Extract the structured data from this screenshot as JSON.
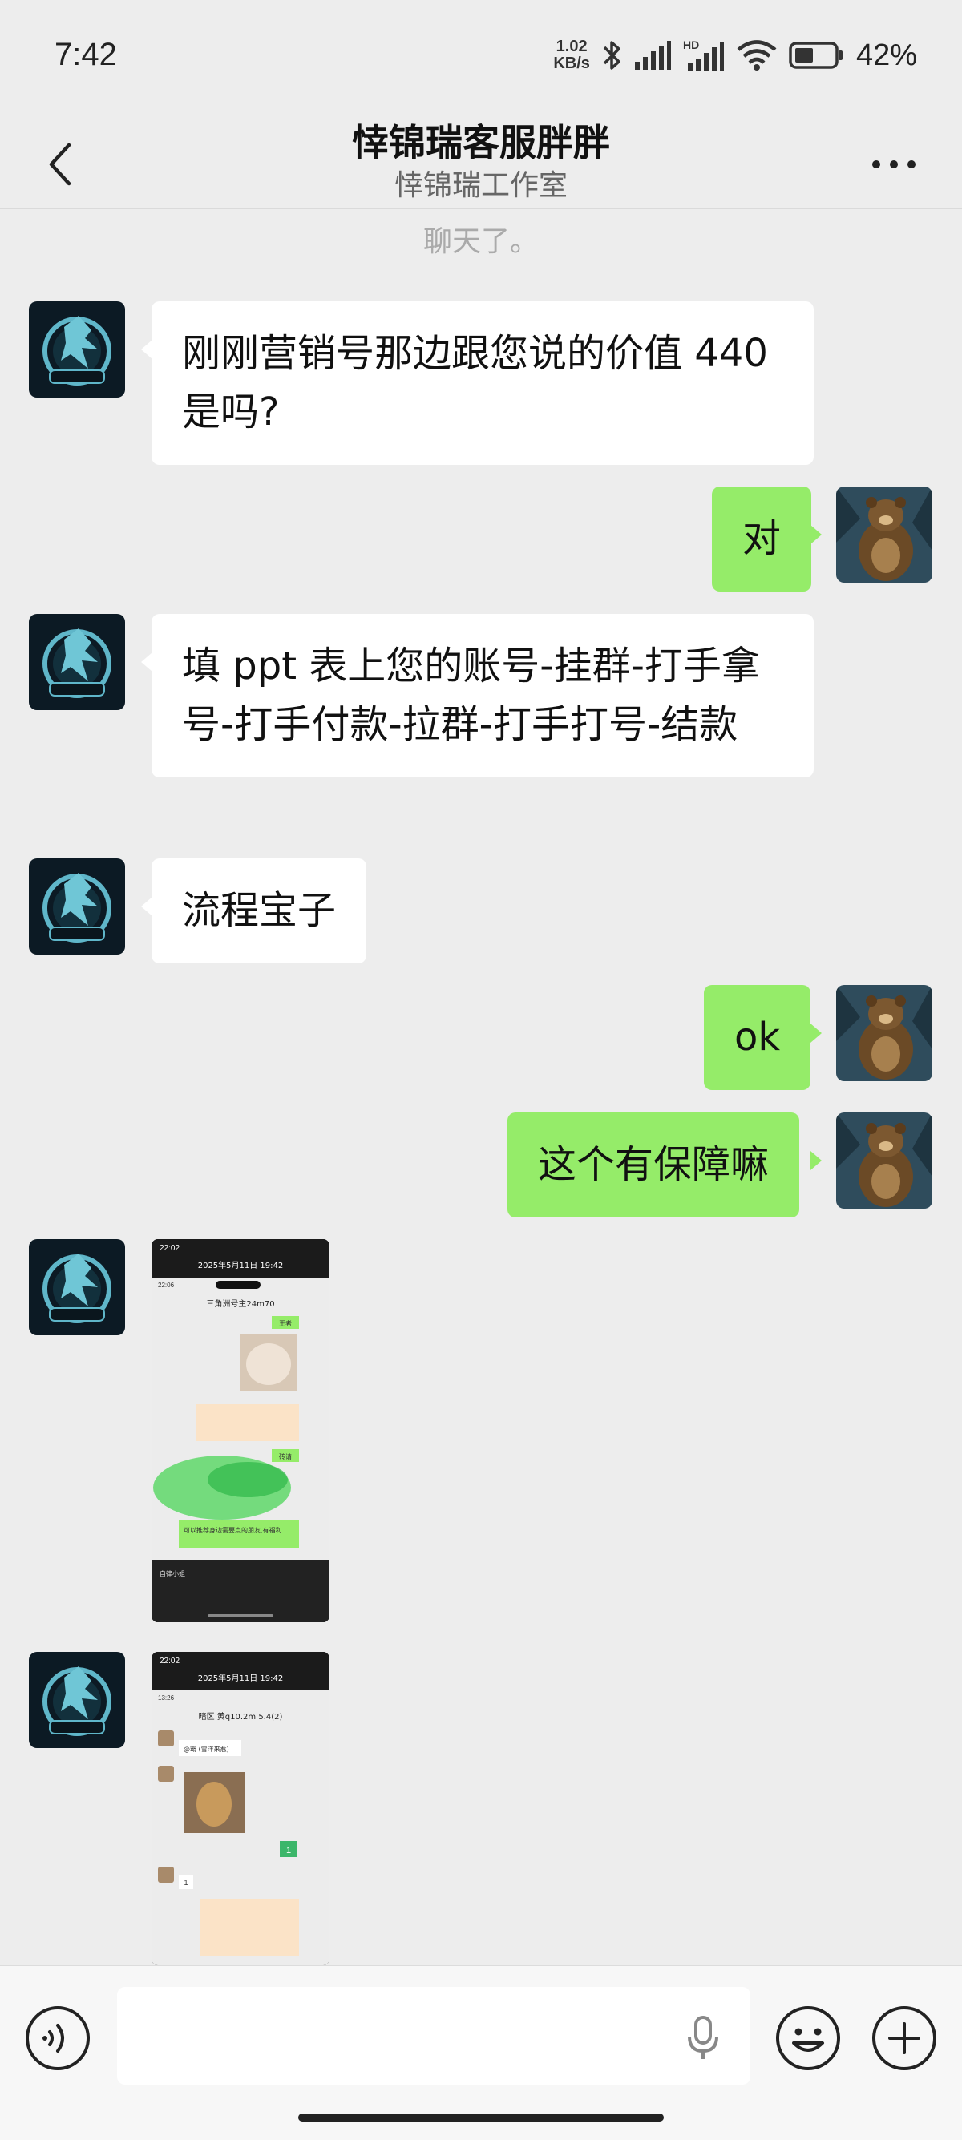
{
  "status_bar": {
    "time": "7:42",
    "net_speed_value": "1.02",
    "net_speed_unit": "KB/s",
    "hd_label": "HD",
    "battery_percent": "42%",
    "icons": [
      "bluetooth-icon",
      "signal-icon",
      "hd-signal-icon",
      "wifi-icon",
      "battery-icon"
    ]
  },
  "header": {
    "title": "悻锦瑞客服胖胖",
    "subtitle": "悻锦瑞工作室",
    "back_icon": "back-arrow-icon",
    "more_icon": "more-icon"
  },
  "system_message": "聊天了。",
  "messages": [
    {
      "side": "left",
      "type": "text",
      "text": "刚刚营销号那边跟您说的价值 440 是吗?"
    },
    {
      "side": "right",
      "type": "text",
      "text": "对"
    },
    {
      "side": "left",
      "type": "text",
      "text": "填 ppt 表上您的账号-挂群-打手拿号-打手付款-拉群-打手打号-结款"
    },
    {
      "side": "left",
      "type": "text",
      "text": "流程宝子"
    },
    {
      "side": "right",
      "type": "text",
      "text": "ok"
    },
    {
      "side": "right",
      "type": "text",
      "text": "这个有保障嘛"
    },
    {
      "side": "left",
      "type": "image",
      "content": {
        "status_time": "22:02",
        "date": "2025年5月11日 19:42",
        "inner_time": "22:06",
        "chat_title": "三角洲号主24m70",
        "bubble_1": "王者",
        "bubble_2": "砖请",
        "caption": "可以推荐身边需要点的朋友,有福利",
        "footer": "自律小姐"
      }
    },
    {
      "side": "left",
      "type": "image",
      "content": {
        "status_time": "22:02",
        "date": "2025年5月11日 19:42",
        "inner_time": "13:26",
        "chat_title": "暗区 黄q10.2m 5.4(2)",
        "bubble_1": "@霸 (雪洋来惹)",
        "bubble_2": "1",
        "bubble_3": "1"
      }
    }
  ],
  "input_bar": {
    "voice_icon": "voice-icon",
    "mic_icon": "mic-icon",
    "emoji_icon": "emoji-icon",
    "plus_icon": "plus-icon"
  },
  "colors": {
    "background": "#ededed",
    "sent_bubble": "#95ec69",
    "received_bubble": "#ffffff"
  }
}
